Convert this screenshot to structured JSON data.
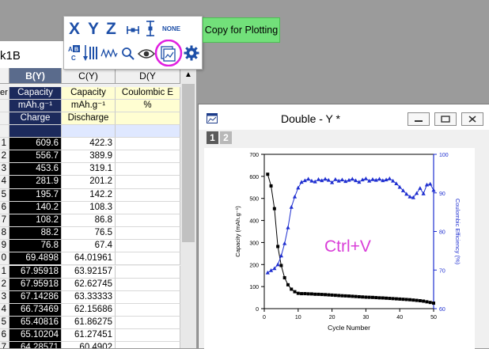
{
  "toolbar": {
    "x_label": "X",
    "y_label": "Y",
    "z_label": "Z",
    "none_label": "NONE",
    "copy_for_plotting": "Copy for Plotting",
    "highlight_color": "#e020e0"
  },
  "worksheet": {
    "title": "k1B",
    "columns": [
      "B(Y)",
      "C(Y)",
      "D(Y"
    ],
    "long_name": [
      "Capacity",
      "Capacity",
      "Coulombic E"
    ],
    "units": [
      "mAh.g⁻¹",
      "mAh.g⁻¹",
      "%"
    ],
    "comments": [
      "Charge",
      "Discharge",
      ""
    ],
    "meta_row_labels": [
      "er",
      "",
      "",
      ""
    ],
    "rows": [
      {
        "n": "1",
        "b": "609.6",
        "c": "422.3"
      },
      {
        "n": "2",
        "b": "556.7",
        "c": "389.9"
      },
      {
        "n": "3",
        "b": "453.6",
        "c": "319.1"
      },
      {
        "n": "4",
        "b": "281.9",
        "c": "201.2"
      },
      {
        "n": "5",
        "b": "195.7",
        "c": "142.2"
      },
      {
        "n": "6",
        "b": "140.2",
        "c": "108.3"
      },
      {
        "n": "7",
        "b": "108.2",
        "c": "86.8"
      },
      {
        "n": "8",
        "b": "88.2",
        "c": "76.5"
      },
      {
        "n": "9",
        "b": "76.8",
        "c": "67.4"
      },
      {
        "n": "0",
        "b": "69.4898",
        "c": "64.01961"
      },
      {
        "n": "1",
        "b": "67.95918",
        "c": "63.92157"
      },
      {
        "n": "2",
        "b": "67.95918",
        "c": "62.62745"
      },
      {
        "n": "3",
        "b": "67.14286",
        "c": "63.33333"
      },
      {
        "n": "4",
        "b": "66.73469",
        "c": "62.15686"
      },
      {
        "n": "5",
        "b": "65.40816",
        "c": "61.86275"
      },
      {
        "n": "6",
        "b": "65.10204",
        "c": "61.27451"
      },
      {
        "n": "7",
        "b": "64.28571",
        "c": "60.4902"
      }
    ]
  },
  "graph": {
    "title": "Double - Y *",
    "layer_tabs": [
      "1",
      "2"
    ],
    "annotation": "Ctrl+V"
  },
  "chart_data": {
    "type": "scatter",
    "xlabel": "Cycle Number",
    "ylabel": "Capacity (mAh.g⁻¹)",
    "y2label": "Coulombic Efficiency (%)",
    "xlim": [
      0,
      50
    ],
    "ylim": [
      0,
      700
    ],
    "y2lim": [
      60,
      100
    ],
    "xticks": [
      0,
      10,
      20,
      30,
      40,
      50
    ],
    "yticks": [
      0,
      100,
      200,
      300,
      400,
      500,
      600,
      700
    ],
    "y2ticks": [
      60,
      70,
      80,
      90,
      100
    ],
    "series": [
      {
        "name": "Capacity",
        "axis": "left",
        "color": "#000000",
        "marker": "square",
        "x": [
          1,
          2,
          3,
          4,
          5,
          6,
          7,
          8,
          9,
          10,
          11,
          12,
          13,
          14,
          15,
          16,
          17,
          18,
          19,
          20,
          21,
          22,
          23,
          24,
          25,
          26,
          27,
          28,
          29,
          30,
          31,
          32,
          33,
          34,
          35,
          36,
          37,
          38,
          39,
          40,
          41,
          42,
          43,
          44,
          45,
          46,
          47,
          48,
          49,
          50
        ],
        "y": [
          609.6,
          556.7,
          453.6,
          281.9,
          195.7,
          140.2,
          108.2,
          88.2,
          76.8,
          69.5,
          68.0,
          68.0,
          67.1,
          66.7,
          65.4,
          65.1,
          64.3,
          63.5,
          62.5,
          61.5,
          60.5,
          59.5,
          58.5,
          57.8,
          57.0,
          56.0,
          55.0,
          54.0,
          53.0,
          52.0,
          51.5,
          51.0,
          50.0,
          49.0,
          48.5,
          47.5,
          46.5,
          45.5,
          44.5,
          43.5,
          42.5,
          41.5,
          40.5,
          39.0,
          37.5,
          36.0,
          34.0,
          31.0,
          28.0,
          25.0
        ]
      },
      {
        "name": "Coulombic Efficiency",
        "axis": "right",
        "color": "#1f2fd0",
        "marker": "triangle",
        "x": [
          1,
          2,
          3,
          4,
          5,
          6,
          7,
          8,
          9,
          10,
          11,
          12,
          13,
          14,
          15,
          16,
          17,
          18,
          19,
          20,
          21,
          22,
          23,
          24,
          25,
          26,
          27,
          28,
          29,
          30,
          31,
          32,
          33,
          34,
          35,
          36,
          37,
          38,
          39,
          40,
          41,
          42,
          43,
          44,
          45,
          46,
          47,
          48,
          49,
          50
        ],
        "y": [
          69.3,
          69.9,
          70.4,
          71.4,
          73.7,
          76.9,
          81.0,
          86.3,
          89.0,
          91.3,
          92.8,
          93.2,
          93.6,
          93.1,
          92.9,
          93.5,
          93.2,
          93.6,
          93.3,
          92.7,
          93.5,
          93.1,
          93.4,
          93.0,
          93.3,
          93.6,
          93.2,
          92.8,
          93.4,
          93.7,
          93.1,
          93.5,
          93.3,
          93.6,
          93.2,
          93.4,
          93.7,
          93.1,
          92.4,
          91.5,
          90.6,
          89.7,
          89.0,
          88.8,
          89.9,
          91.2,
          89.8,
          92.1,
          92.3,
          90.7
        ]
      }
    ]
  }
}
